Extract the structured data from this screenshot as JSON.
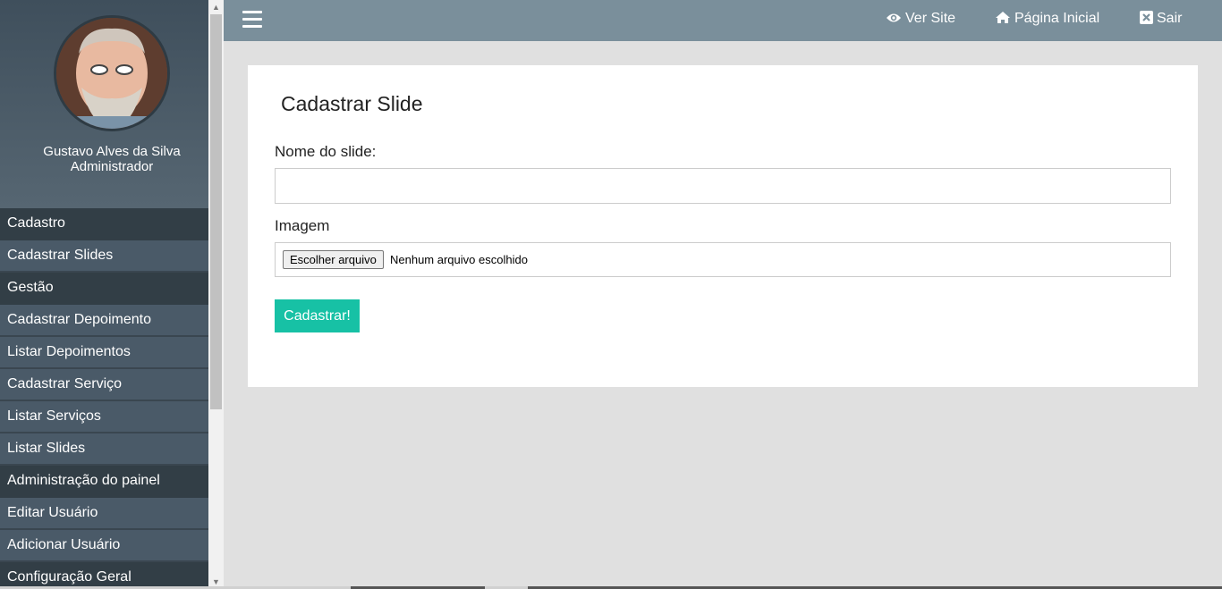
{
  "profile": {
    "name": "Gustavo Alves da Silva",
    "role": "Administrador"
  },
  "sidebar": {
    "sections": [
      {
        "header": "Cadastro",
        "items": [
          "Cadastrar Slides"
        ]
      },
      {
        "header": "Gestão",
        "items": [
          "Cadastrar Depoimento",
          "Listar Depoimentos",
          "Cadastrar Serviço",
          "Listar Serviços",
          "Listar Slides"
        ]
      },
      {
        "header": "Administração do painel",
        "items": [
          "Editar Usuário",
          "Adicionar Usuário"
        ]
      },
      {
        "header": "Configuração Geral",
        "items": []
      }
    ]
  },
  "topbar": {
    "menu_icon": "hamburger-icon",
    "links": [
      {
        "label": "Ver Site",
        "icon": "eye-icon"
      },
      {
        "label": "Página Inicial",
        "icon": "home-icon"
      },
      {
        "label": "Sair",
        "icon": "close-square-icon"
      }
    ]
  },
  "form": {
    "title": "Cadastrar Slide",
    "name_label": "Nome do slide:",
    "name_value": "",
    "image_label": "Imagem",
    "file_button": "Escolher arquivo",
    "file_status": "Nenhum arquivo escolhido",
    "submit": "Cadastrar!"
  },
  "colors": {
    "sidebar": "#4a5a68",
    "sidebar_header": "#323e46",
    "topbar": "#7a8f9b",
    "accent": "#17c1a5",
    "background": "#e0e0e0"
  }
}
